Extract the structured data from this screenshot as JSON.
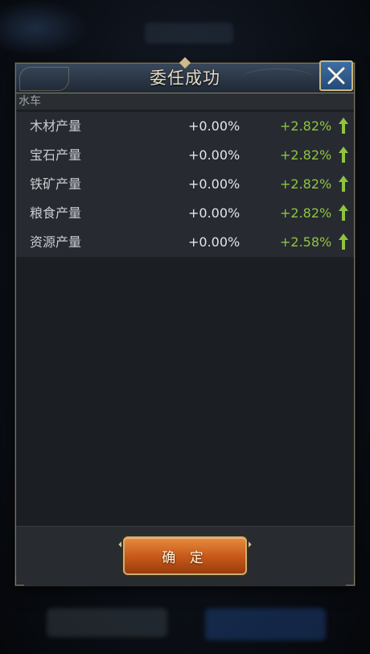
{
  "dialog": {
    "title": "委任成功",
    "close_icon": "close-icon",
    "category": "水车",
    "rows": [
      {
        "label": "木材产量",
        "base": "+0.00%",
        "bonus": "+2.82%",
        "icon": "arrow-up-icon"
      },
      {
        "label": "宝石产量",
        "base": "+0.00%",
        "bonus": "+2.82%",
        "icon": "arrow-up-icon"
      },
      {
        "label": "铁矿产量",
        "base": "+0.00%",
        "bonus": "+2.82%",
        "icon": "arrow-up-icon"
      },
      {
        "label": "粮食产量",
        "base": "+0.00%",
        "bonus": "+2.82%",
        "icon": "arrow-up-icon"
      },
      {
        "label": "资源产量",
        "base": "+0.00%",
        "bonus": "+2.58%",
        "icon": "arrow-up-icon"
      }
    ],
    "confirm_label": "确 定"
  },
  "colors": {
    "bonus_green": "#8fc43e",
    "confirm_orange": "#c95b1b",
    "close_blue": "#2f5d90",
    "gold_border": "#c9b782"
  }
}
